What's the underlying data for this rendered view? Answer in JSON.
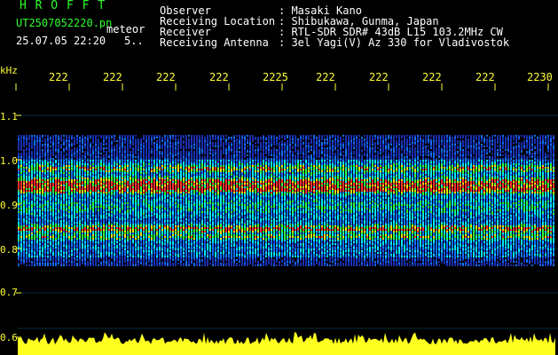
{
  "header": {
    "app_name": "H R O F F T",
    "file_name": "UT2507052220.pn",
    "mode": "meteor",
    "date_time": "25.07.05 22:20",
    "extra": "5..",
    "fields": [
      {
        "label": "Observer",
        "value": ": Masaki Kano"
      },
      {
        "label": "Receiving Location",
        "value": ": Shibukawa, Gunma, Japan"
      },
      {
        "label": "Receiver",
        "value": ": RTL-SDR SDR# 43dB L15 103.2MHz CW"
      },
      {
        "label": "Receiving Antenna",
        "value": ": 3el Yagi(V) Az 330 for Vladivostok"
      }
    ]
  },
  "y_axis": {
    "unit": "kHz",
    "ticks": [
      "1.1",
      "1.0",
      "0.9",
      "0.8",
      "0.7",
      "0.6"
    ]
  },
  "time_axis": {
    "ticks": [
      "222",
      "222",
      "222",
      "222",
      "2225",
      "222",
      "222",
      "222",
      "222",
      "2230"
    ]
  },
  "colors": {
    "background": "#000000",
    "text": "#ffffff",
    "title": "#2fff2f",
    "axis": "#ffff33",
    "gridline": "#00c8ff"
  }
}
